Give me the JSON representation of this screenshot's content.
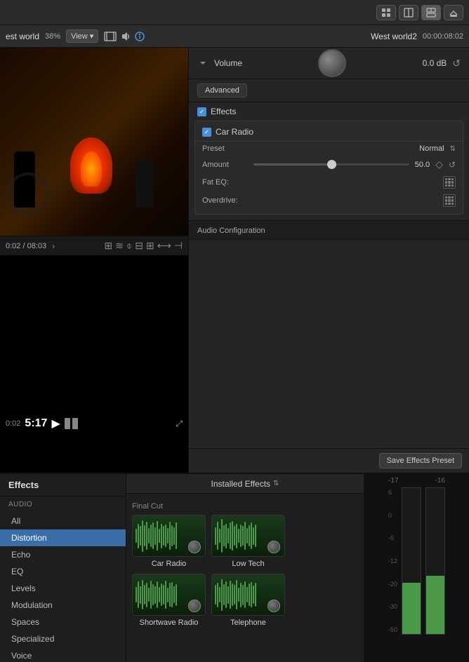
{
  "topToolbar": {
    "buttons": [
      "grid-view",
      "split-view",
      "timeline-view",
      "export"
    ]
  },
  "headerBar": {
    "title": "est world",
    "zoom": "38%",
    "viewLabel": "View",
    "clipName": "West world2",
    "timecode": "00:00:08:02"
  },
  "videoPreview": {
    "timecodeOverlay": "5:17",
    "timecodeSmall": "0:02 / 08:03",
    "playIcon": "▶"
  },
  "inspector": {
    "volumeLabel": "Volume",
    "volumeValue": "0.0 dB",
    "advancedLabel": "Advanced",
    "effectsLabel": "Effects",
    "carRadioLabel": "Car Radio",
    "presetLabel": "Preset",
    "presetValue": "Normal",
    "amountLabel": "Amount",
    "amountValue": "50.0",
    "fatEqLabel": "Fat EQ:",
    "overdriveLabel": "Overdrive:",
    "audioConfigLabel": "Audio Configuration",
    "savePresetLabel": "Save Effects Preset"
  },
  "effectsSidebar": {
    "header": "Effects",
    "audioHeader": "AUDIO",
    "items": [
      "All",
      "Distortion",
      "Echo",
      "EQ",
      "Levels",
      "Modulation",
      "Spaces",
      "Specialized",
      "Voice"
    ]
  },
  "effectsGrid": {
    "headerLabel": "Installed Effects",
    "sortIcon": "⇅",
    "categoryLabel": "Final Cut",
    "effects": [
      {
        "name": "Car Radio"
      },
      {
        "name": "Low Tech"
      },
      {
        "name": "Shortwave Radio"
      },
      {
        "name": "Telephone"
      }
    ]
  },
  "audioMeter": {
    "labels": [
      "-17",
      "-16"
    ],
    "dbMarkers": [
      "6",
      "0",
      "-6",
      "-12",
      "-20",
      "-30",
      "-50"
    ]
  }
}
